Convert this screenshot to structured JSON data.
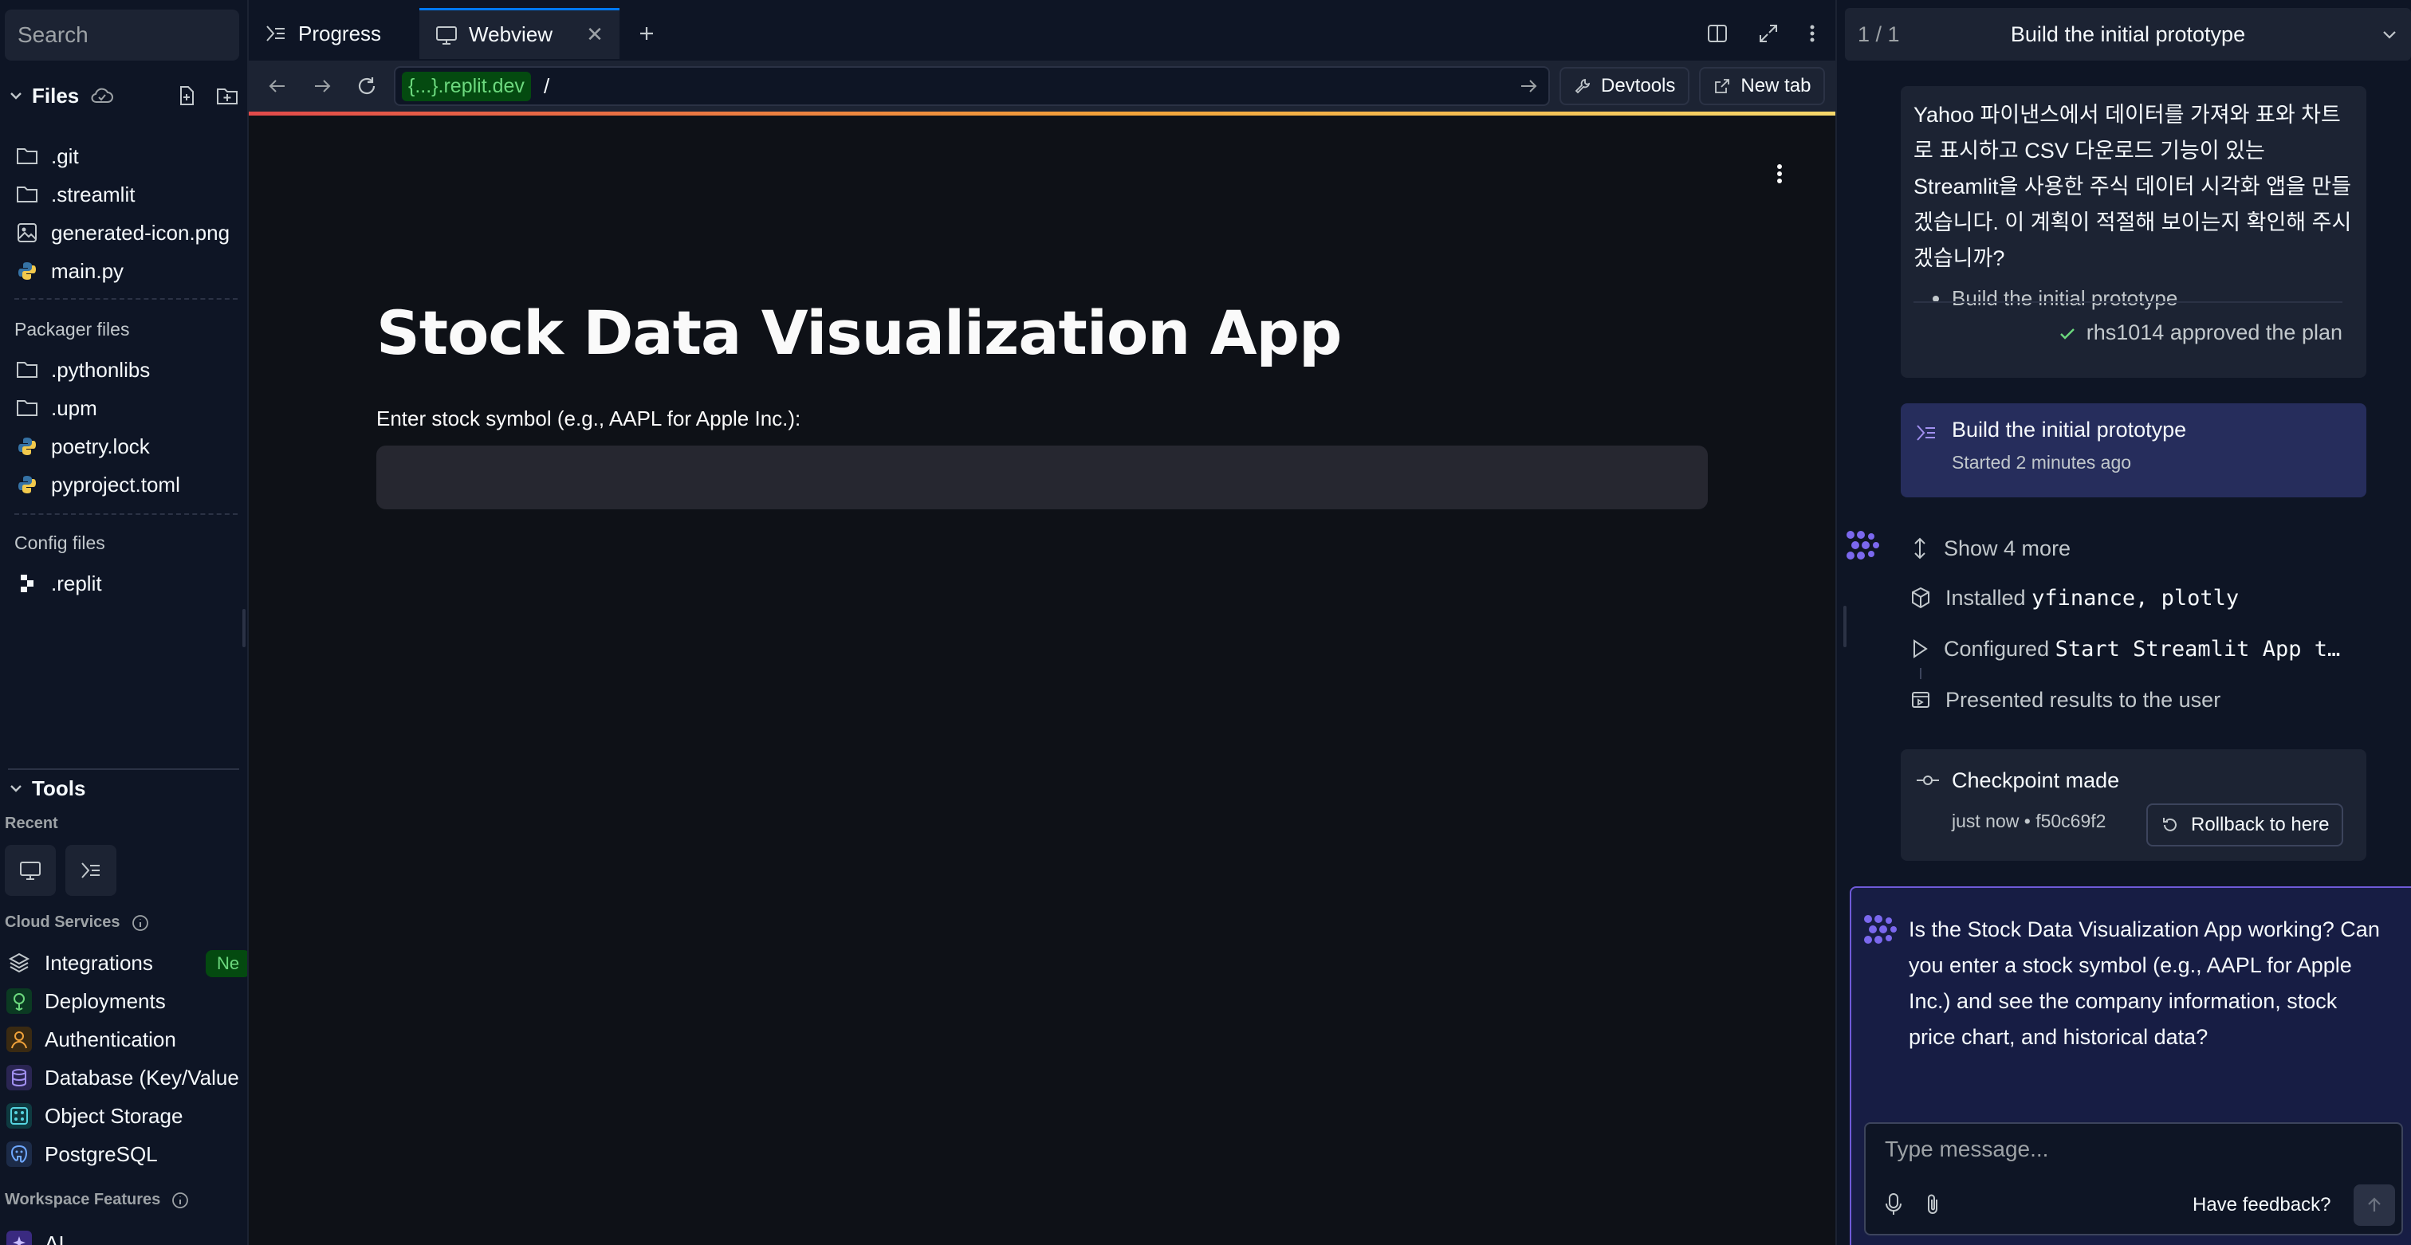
{
  "sidebar": {
    "search_placeholder": "Search",
    "files_title": "Files",
    "files": [
      {
        "name": ".git",
        "icon": "folder-icon"
      },
      {
        "name": ".streamlit",
        "icon": "folder-icon"
      },
      {
        "name": "generated-icon.png",
        "icon": "image-icon"
      },
      {
        "name": "main.py",
        "icon": "python-icon"
      }
    ],
    "packager_label": "Packager files",
    "packager_files": [
      {
        "name": ".pythonlibs",
        "icon": "folder-icon"
      },
      {
        "name": ".upm",
        "icon": "folder-icon"
      },
      {
        "name": "poetry.lock",
        "icon": "python-icon"
      },
      {
        "name": "pyproject.toml",
        "icon": "python-icon"
      }
    ],
    "config_label": "Config files",
    "config_files": [
      {
        "name": ".replit",
        "icon": "replit-icon"
      }
    ],
    "tools_title": "Tools",
    "recent_label": "Recent",
    "cloud_label": "Cloud Services",
    "services": [
      {
        "name": "Integrations",
        "icon": "layers-icon"
      },
      {
        "name": "Deployments",
        "icon": "deploy-icon"
      },
      {
        "name": "Authentication",
        "icon": "user-icon"
      },
      {
        "name": "Database (Key/Value",
        "icon": "database-icon"
      },
      {
        "name": "Object Storage",
        "icon": "storage-icon"
      },
      {
        "name": "PostgreSQL",
        "icon": "postgres-icon"
      }
    ],
    "new_badge": "Ne",
    "workspace_label": "Workspace Features",
    "ai_label": "AI"
  },
  "tabs": [
    {
      "label": "Progress",
      "icon": "progress-icon"
    },
    {
      "label": "Webview",
      "icon": "monitor-icon"
    }
  ],
  "urlbar": {
    "domain": "{...}.replit.dev",
    "path": "/",
    "devtools": "Devtools",
    "new_tab": "New tab"
  },
  "webview": {
    "title": "Stock Data Visualization App",
    "input_label": "Enter stock symbol (e.g., AAPL for Apple Inc.):",
    "input_value": ""
  },
  "right_panel": {
    "plan_count": "1 / 1",
    "plan_title": "Build the initial prototype",
    "plan_text": "Yahoo 파이낸스에서 데이터를 가져와 표와 차트로 표시하고 CSV 다운로드 기능이 있는 Streamlit을 사용한 주식 데이터 시각화 앱을 만들겠습니다. 이 계획이 적절해 보이는지 확인해 주시겠습니까?",
    "plan_bullet": "Build the initial prototype",
    "approved": "rhs1014 approved the plan",
    "task_title": "Build the initial prototype",
    "task_started": "Started",
    "task_time": "2 minutes ago",
    "show_more": "Show 4 more",
    "installed_label": "Installed",
    "installed_pkgs": "yfinance, plotly",
    "configured_label": "Configured",
    "configured_item": "Start Streamlit App t…",
    "presented": "Presented results to the user",
    "checkpoint_title": "Checkpoint made",
    "checkpoint_sub": "just now • f50c69f2",
    "rollback": "Rollback to here",
    "question": "Is the Stock Data Visualization App working? Can you enter a stock symbol (e.g., AAPL for Apple Inc.) and see the company information, stock price chart, and historical data?",
    "message_placeholder": "Type message...",
    "feedback": "Have feedback?"
  },
  "colors": {
    "background": "#0e1525",
    "surface": "#1c2333",
    "accent": "#0079f2",
    "agent_purple": "#6f5ad8",
    "success": "#6cd97e",
    "webview_bg": "#0e1117"
  }
}
